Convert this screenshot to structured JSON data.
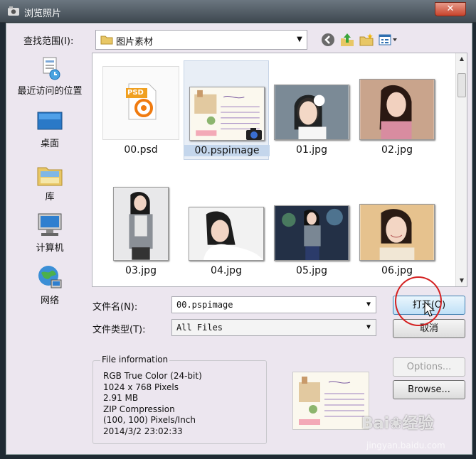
{
  "window": {
    "title": "浏览照片",
    "close_label": "✕"
  },
  "lookin": {
    "label": "查找范围(I):",
    "value": "图片素材"
  },
  "places": [
    {
      "label": "最近访问的位置",
      "icon": "recent-places-icon"
    },
    {
      "label": "桌面",
      "icon": "desktop-icon"
    },
    {
      "label": "库",
      "icon": "libraries-icon"
    },
    {
      "label": "计算机",
      "icon": "computer-icon"
    },
    {
      "label": "网络",
      "icon": "network-icon"
    }
  ],
  "files": [
    {
      "name": "00.psd",
      "kind": "psd"
    },
    {
      "name": "00.pspimage",
      "kind": "pspimage",
      "selected": true
    },
    {
      "name": "01.jpg"
    },
    {
      "name": "02.jpg"
    },
    {
      "name": "03.jpg"
    },
    {
      "name": "04.jpg"
    },
    {
      "name": "05.jpg"
    },
    {
      "name": "06.jpg"
    }
  ],
  "psd_badge": "PSD",
  "filename": {
    "label": "文件名(N):",
    "value": "00.pspimage"
  },
  "filetype": {
    "label": "文件类型(T):",
    "value": "All Files"
  },
  "buttons": {
    "open": "打开(O)",
    "cancel": "取消",
    "options": "Options...",
    "browse": "Browse..."
  },
  "info": {
    "legend": "File information",
    "lines": [
      "RGB True Color (24-bit)",
      "1024 x 768 Pixels",
      "2.91 MB",
      "ZIP Compression",
      "(100, 100) Pixels/Inch",
      "2014/3/2  23:02:33"
    ]
  },
  "watermark": {
    "brand": "Bai❀经验",
    "url": "jingyan.baidu.com"
  },
  "colors": {
    "accent": "#3c7fb1",
    "annotation": "#d42020"
  }
}
